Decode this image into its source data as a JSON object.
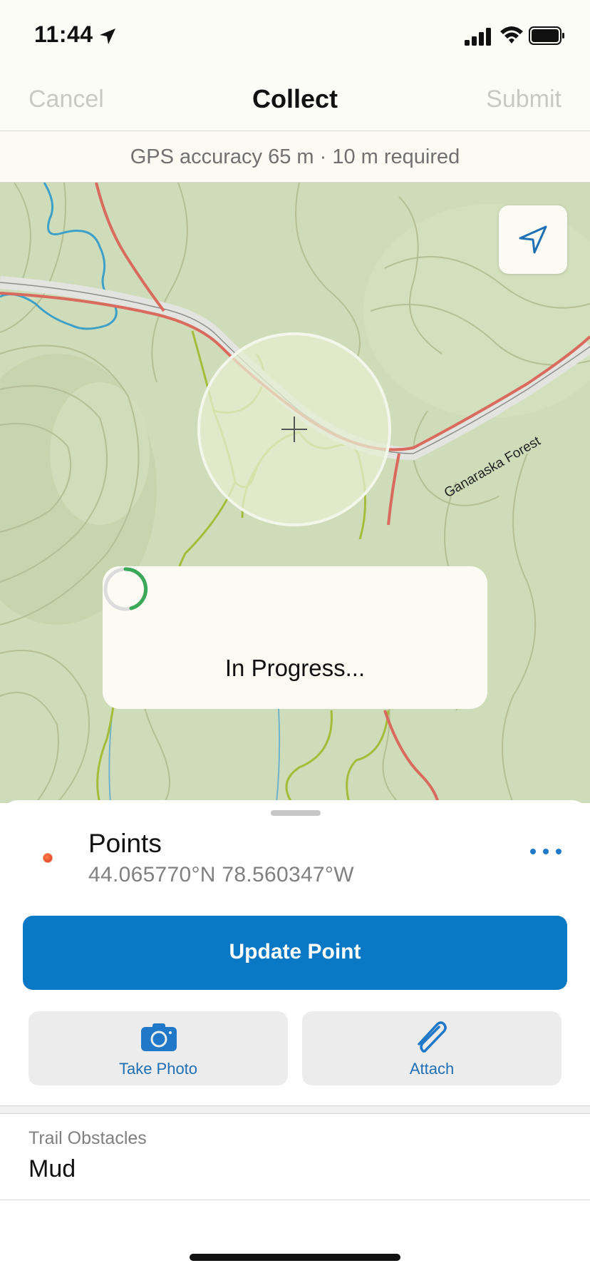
{
  "status_bar": {
    "time": "11:44"
  },
  "nav": {
    "cancel_label": "Cancel",
    "title": "Collect",
    "submit_label": "Submit"
  },
  "gps": {
    "text": "GPS accuracy 65 m  ·  10 m required"
  },
  "map": {
    "road_label": "Ganaraska Forest",
    "progress_text": "In Progress...",
    "colors": {
      "background": "#cfdcb9",
      "contour": "#b5bf97",
      "trail": "#a3bd3a",
      "road": "#d96a5e",
      "water": "#3ea0c8",
      "accuracy_circle": "#e6efd2"
    }
  },
  "feature": {
    "layer_name": "Points",
    "coordinates": "44.065770°N  78.560347°W"
  },
  "actions": {
    "update_label": "Update Point",
    "take_photo_label": "Take Photo",
    "attach_label": "Attach"
  },
  "form": {
    "field_label": "Trail Obstacles",
    "field_value": "Mud"
  },
  "icons": {
    "location_arrow": "location-arrow-icon",
    "signal": "cellular-signal-icon",
    "wifi": "wifi-icon",
    "battery": "battery-icon",
    "locate": "navigation-arrow-icon",
    "camera": "camera-icon",
    "paperclip": "paperclip-icon",
    "more": "more-horizontal-icon"
  },
  "accent_color": "#0a78c4"
}
